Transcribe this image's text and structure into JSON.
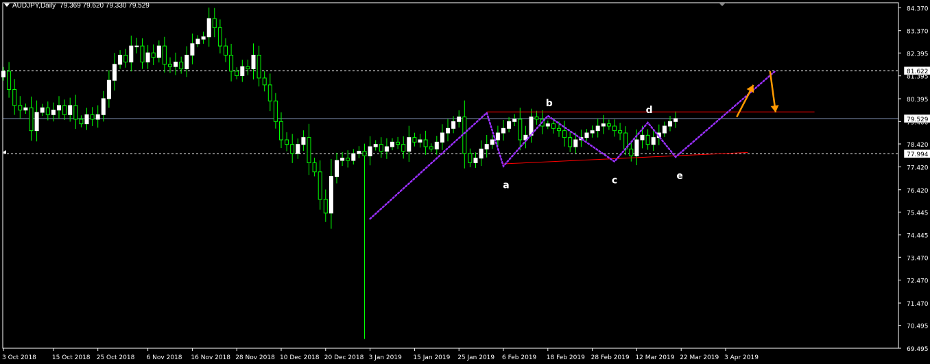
{
  "header": {
    "symbol_timeframe": "AUDJPY,Daily",
    "ohlc": "79.369 79.620 79.330 79.529"
  },
  "colors": {
    "background": "#000000",
    "foreground": "#ffffff",
    "bull_candle": "#ffffff",
    "bear_candle": "#000000",
    "wick": "#00ff00",
    "pattern_line": "#9b30ff",
    "trend_line": "#ff0000",
    "price_line": "#7f8fb2",
    "arrow": "#ff9900"
  },
  "chart_data": {
    "type": "candlestick",
    "symbol": "AUDJPY",
    "timeframe": "Daily",
    "ylim": [
      69.495,
      84.59
    ],
    "y_ticks": [
      84.37,
      83.37,
      82.395,
      81.395,
      80.395,
      79.4,
      78.42,
      77.42,
      76.42,
      75.445,
      74.445,
      73.47,
      72.47,
      71.47,
      70.495,
      69.495
    ],
    "x_ticks": [
      {
        "label": "3 Oct 2018",
        "index": 0
      },
      {
        "label": "15 Oct 2018",
        "index": 9
      },
      {
        "label": "25 Oct 2018",
        "index": 17
      },
      {
        "label": "6 Nov 2018",
        "index": 26
      },
      {
        "label": "16 Nov 2018",
        "index": 34
      },
      {
        "label": "28 Nov 2018",
        "index": 42
      },
      {
        "label": "10 Dec 2018",
        "index": 50
      },
      {
        "label": "20 Dec 2018",
        "index": 58
      },
      {
        "label": "3 Jan 2019",
        "index": 66
      },
      {
        "label": "15 Jan 2019",
        "index": 74
      },
      {
        "label": "25 Jan 2019",
        "index": 82
      },
      {
        "label": "6 Feb 2019",
        "index": 90
      },
      {
        "label": "18 Feb 2019",
        "index": 98
      },
      {
        "label": "28 Feb 2019",
        "index": 106
      },
      {
        "label": "12 Mar 2019",
        "index": 114
      },
      {
        "label": "22 Mar 2019",
        "index": 122
      },
      {
        "label": "3 Apr 2019",
        "index": 130
      }
    ],
    "closes": [
      81.6,
      80.8,
      80.1,
      79.9,
      80.0,
      79.0,
      79.8,
      80.0,
      79.7,
      79.9,
      80.1,
      79.7,
      80.1,
      79.5,
      79.3,
      79.7,
      79.5,
      79.7,
      80.4,
      81.2,
      81.9,
      82.3,
      82.0,
      82.7,
      82.7,
      82.0,
      82.4,
      82.2,
      82.7,
      81.9,
      81.8,
      82.0,
      81.7,
      82.3,
      82.8,
      83.0,
      83.1,
      83.9,
      83.5,
      82.7,
      82.3,
      81.6,
      81.4,
      81.8,
      81.7,
      82.3,
      81.3,
      81.0,
      80.3,
      79.4,
      78.6,
      78.4,
      78.0,
      78.4,
      78.7,
      77.6,
      77.2,
      76.0,
      75.4,
      77.0,
      77.7,
      77.8,
      77.7,
      78.0,
      78.1,
      77.9,
      78.3,
      78.4,
      78.1,
      78.3,
      78.5,
      78.4,
      78.1,
      78.7,
      78.5,
      78.6,
      78.3,
      78.2,
      78.5,
      78.9,
      79.1,
      79.4,
      79.6,
      78.0,
      77.6,
      77.8,
      78.2,
      78.4,
      78.6,
      78.9,
      79.1,
      79.4,
      79.5,
      78.6,
      78.8,
      79.6,
      79.5,
      79.2,
      79.3,
      79.1,
      79.0,
      78.7,
      78.3,
      78.6,
      78.7,
      78.9,
      79.0,
      79.2,
      79.3,
      79.2,
      79.0,
      78.9,
      78.2,
      77.9,
      78.6,
      78.8,
      78.4,
      78.7,
      78.9,
      79.2,
      79.4,
      79.53
    ],
    "special_candles": [
      {
        "index": 65,
        "low": 69.9
      }
    ],
    "current_price": 79.529,
    "price_labels": [
      81.622,
      79.529,
      77.994
    ],
    "dashed_levels": [
      81.622,
      77.994
    ],
    "pattern_points": [
      {
        "label": "",
        "index": 66,
        "price": 75.15
      },
      {
        "label": "",
        "index": 87,
        "price": 79.78
      },
      {
        "label": "a",
        "index": 90,
        "price": 77.45
      },
      {
        "label": "b",
        "index": 98,
        "price": 79.65
      },
      {
        "label": "c",
        "index": 110,
        "price": 77.65
      },
      {
        "label": "d",
        "index": 116,
        "price": 79.35
      },
      {
        "label": "e",
        "index": 121,
        "price": 77.85
      },
      {
        "label": "",
        "index": 139,
        "price": 81.62
      }
    ],
    "trend_lines": [
      {
        "from": {
          "index": 87,
          "price": 79.82
        },
        "to": {
          "index": 146,
          "price": 79.82
        }
      },
      {
        "from": {
          "index": 90,
          "price": 77.55
        },
        "to": {
          "index": 134,
          "price": 78.05
        }
      }
    ],
    "arrows": [
      {
        "direction": "up",
        "from": {
          "index": 132,
          "price": 79.6
        },
        "to": {
          "index": 135,
          "price": 81.0
        }
      },
      {
        "direction": "down",
        "from": {
          "index": 138,
          "price": 81.6
        },
        "to": {
          "index": 139,
          "price": 79.8
        }
      }
    ]
  }
}
